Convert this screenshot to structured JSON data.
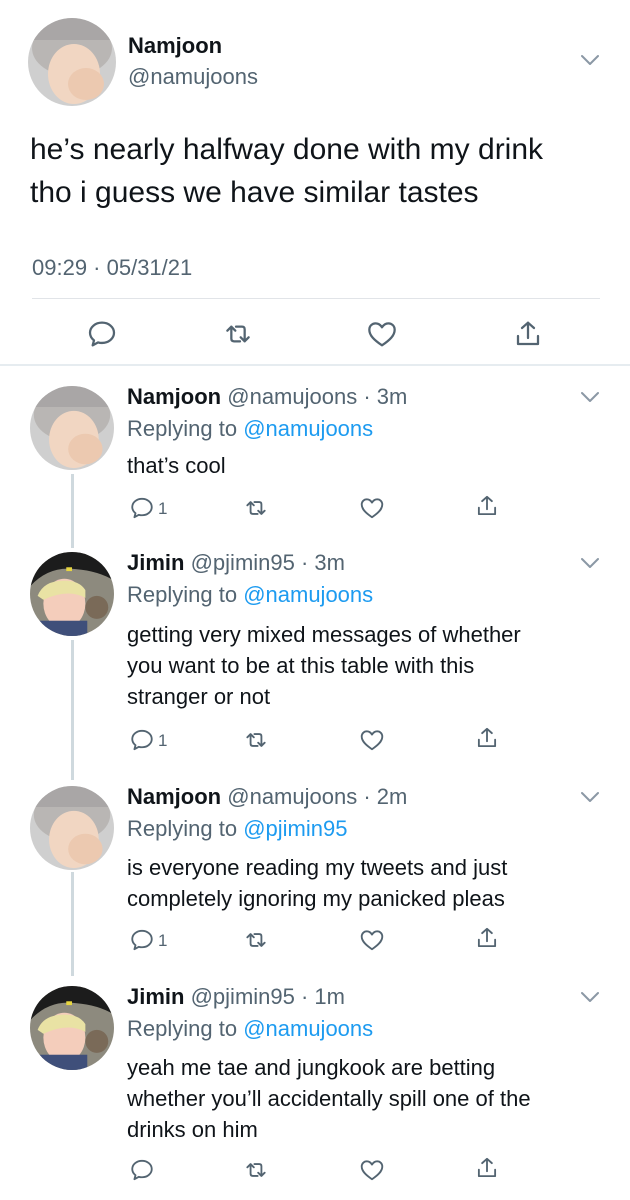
{
  "main_tweet": {
    "name": "Namjoon",
    "handle": "@namujoons",
    "text_line1": "he’s nearly halfway done with my drink",
    "text_line2": "tho i guess we have similar tastes",
    "timestamp": "09:29 · 05/31/21"
  },
  "replies": [
    {
      "name": "Namjoon",
      "meta": "@namujoons · 3m",
      "replying_prefix": "Replying to ",
      "replying_to": "@namujoons",
      "lines": [
        "that’s cool"
      ],
      "reply_count": "1"
    },
    {
      "name": "Jimin",
      "meta": "@pjimin95 · 3m",
      "replying_prefix": "Replying to ",
      "replying_to": "@namujoons",
      "lines": [
        "getting very mixed messages of whether",
        "you want to be at this table with this",
        "stranger or not"
      ],
      "reply_count": "1"
    },
    {
      "name": "Namjoon",
      "meta": "@namujoons · 2m",
      "replying_prefix": "Replying to ",
      "replying_to": "@pjimin95",
      "lines": [
        "is everyone reading my tweets and just",
        "completely ignoring my panicked pleas"
      ],
      "reply_count": "1"
    },
    {
      "name": "Jimin",
      "meta": "@pjimin95 · 1m",
      "replying_prefix": "Replying to ",
      "replying_to": "@namujoons",
      "lines": [
        "yeah me tae and jungkook are betting",
        "whether you’ll accidentally spill one of the",
        "drinks on him"
      ],
      "reply_count": ""
    }
  ],
  "icons": {
    "reply": "reply-icon",
    "retweet": "retweet-icon",
    "like": "like-icon",
    "share": "share-icon",
    "more": "chevron-down-icon"
  },
  "colors": {
    "link": "#1d9bf0",
    "muted": "#536471",
    "text": "#0f1419",
    "divider": "#e1e4e8"
  }
}
